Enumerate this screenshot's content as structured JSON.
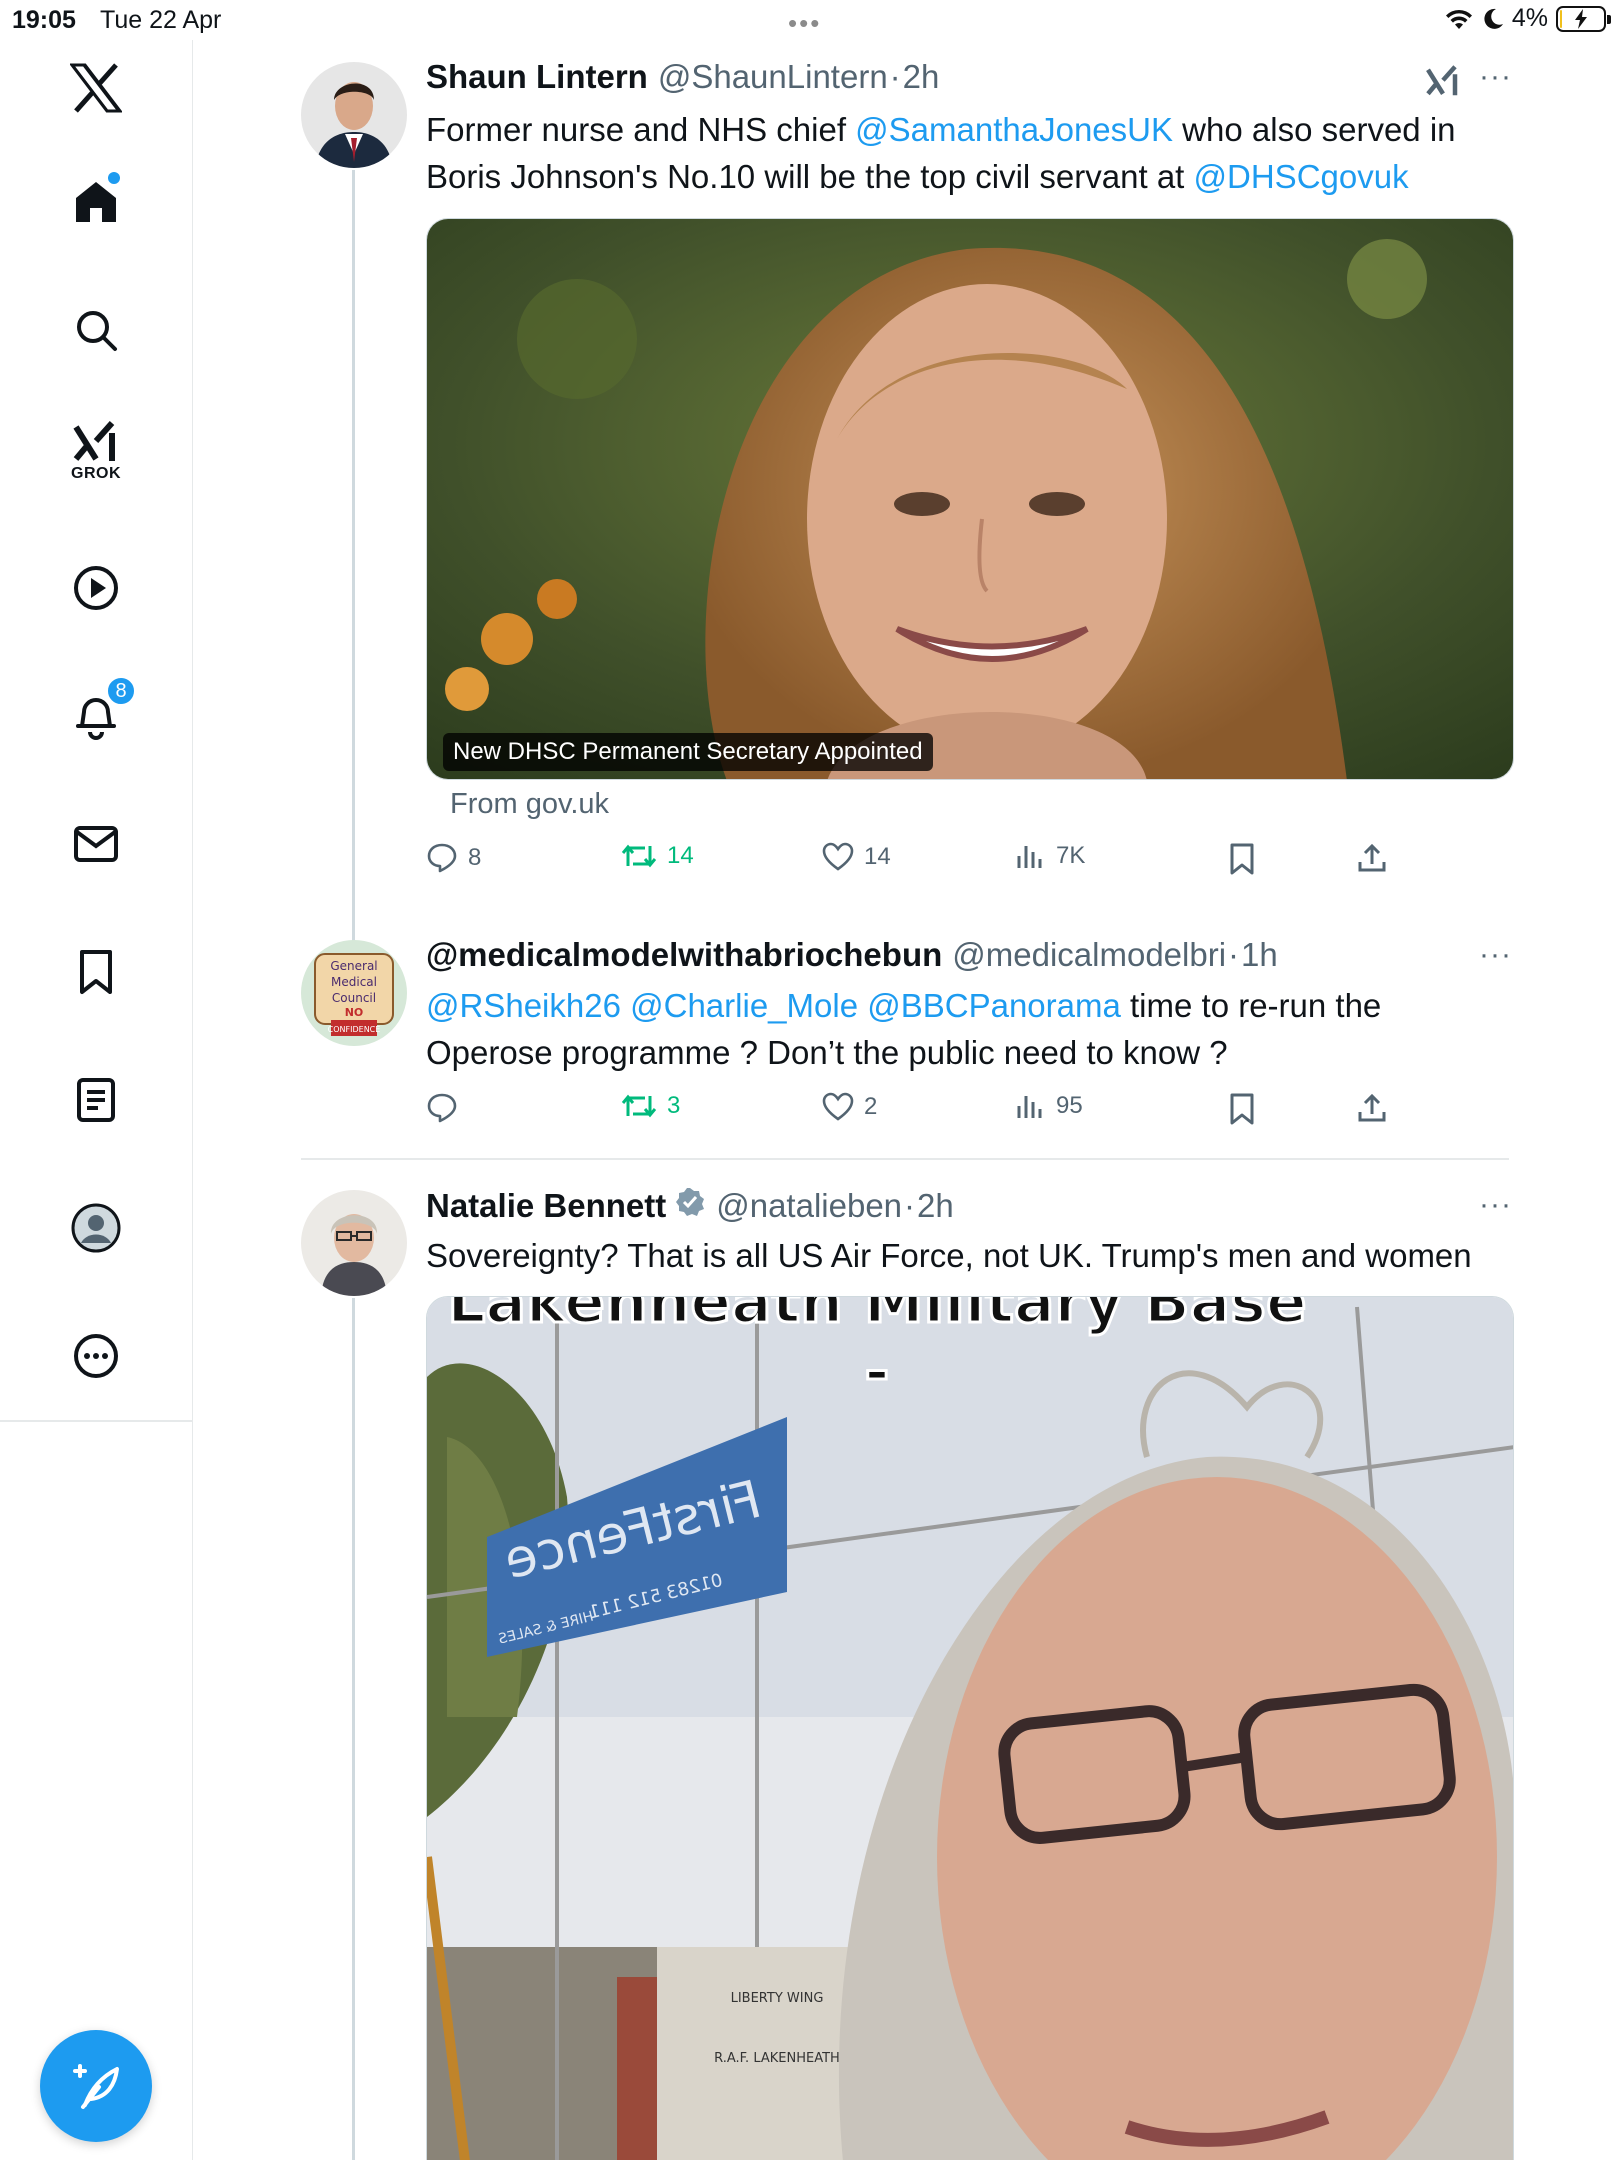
{
  "status_bar": {
    "time": "19:05",
    "date": "Tue 22 Apr",
    "battery": "4%",
    "battery_level": 0.04
  },
  "sidebar": {
    "grok_label": "GROK",
    "notifications_badge": "8",
    "items": [
      "x-logo",
      "home",
      "search",
      "grok",
      "video",
      "notifications",
      "messages",
      "bookmarks",
      "lists",
      "profile",
      "more"
    ]
  },
  "colors": {
    "accent": "#1d9bf0",
    "retweet_green": "#00ba7c",
    "secondary_text": "#536471"
  },
  "tweets": [
    {
      "name": "Shaun Lintern",
      "handle": "@ShaunLintern",
      "time": "2h",
      "text": [
        {
          "t": "Former nurse and NHS chief ",
          "m": false
        },
        {
          "t": "@SamanthaJonesUK",
          "m": true
        },
        {
          "t": " who also served in Boris Johnson's No.10 will be the top civil servant at ",
          "m": false
        },
        {
          "t": "@DHSCgovuk",
          "m": true
        }
      ],
      "media_caption": "New DHSC Permanent Secretary Appointed",
      "source": "From gov.uk",
      "replies": "8",
      "retweets": "14",
      "likes": "14",
      "views": "7K"
    },
    {
      "name": "@medicalmodelwithabriochebun",
      "handle": "@medicalmodelbri",
      "time": "1h",
      "avatar_text": [
        "General",
        "Medical",
        "Council",
        "NO",
        "CONFIDENCE"
      ],
      "text": [
        {
          "t": "@RSheikh26",
          "m": true
        },
        {
          "t": " ",
          "m": false
        },
        {
          "t": "@Charlie_Mole",
          "m": true
        },
        {
          "t": " ",
          "m": false
        },
        {
          "t": "@BBCPanorama",
          "m": true
        },
        {
          "t": " time to re-run the Operose programme ? Don’t the public need to know ?",
          "m": false
        }
      ],
      "replies": "",
      "retweets": "3",
      "likes": "2",
      "views": "95"
    },
    {
      "name": "Natalie Bennett",
      "handle": "@natalieben",
      "time": "2h",
      "text": [
        {
          "t": "Sovereignty? That is all US Air Force, not UK. Trump's men and women",
          "m": false
        }
      ],
      "media_overlay_text": "Lakenheath Military Base -",
      "sign_text": "FirstFence",
      "sign_phone": "01283 512 111",
      "sign_sub": "HIRE & SALES",
      "gate_sign_lines": [
        "LIBERTY WING",
        "R.A.F. LAKENHEATH"
      ]
    }
  ]
}
